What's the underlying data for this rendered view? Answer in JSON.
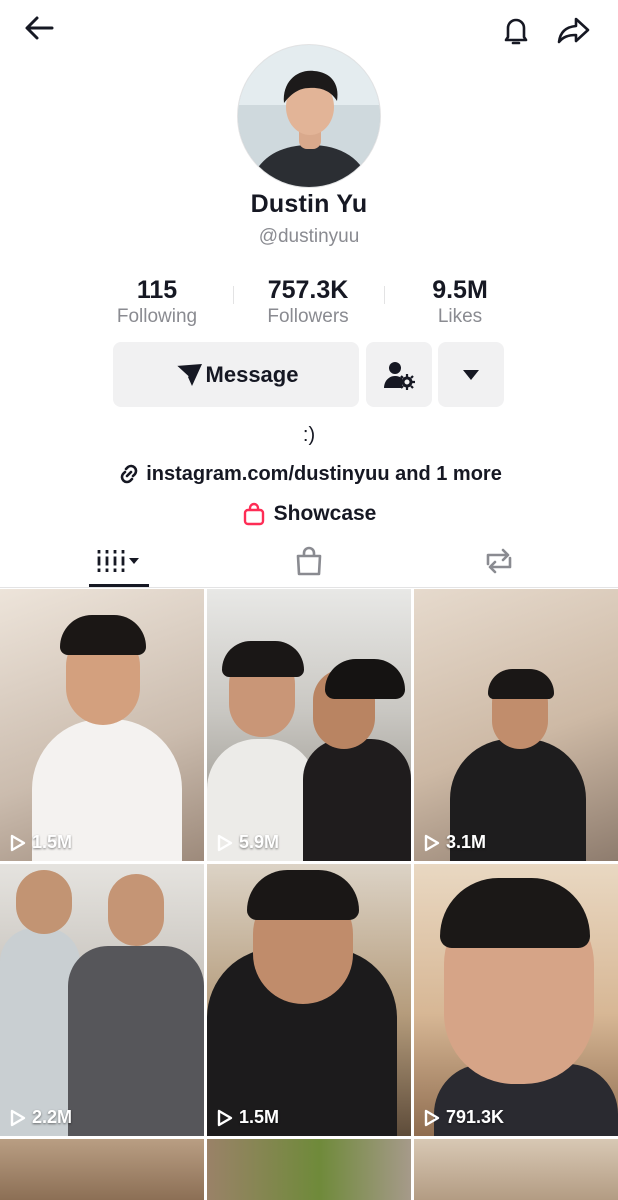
{
  "header": {
    "back_icon": "arrow-left-icon",
    "notify_icon": "bell-icon",
    "share_icon": "share-arrow-icon"
  },
  "profile": {
    "name": "Dustin Yu",
    "handle": "@dustinyuu",
    "stats": [
      {
        "value": "115",
        "label": "Following"
      },
      {
        "value": "757.3K",
        "label": "Followers"
      },
      {
        "value": "9.5M",
        "label": "Likes"
      }
    ],
    "message_label": "Message",
    "bio": ":)",
    "link_text": "instagram.com/dustinyuu and 1 more",
    "showcase_label": "Showcase",
    "accent_color": "#fe2c55"
  },
  "tabs": [
    {
      "name": "videos",
      "icon": "grid-bars-icon",
      "active": true
    },
    {
      "name": "shop",
      "icon": "shopping-bag-icon",
      "active": false
    },
    {
      "name": "reposts",
      "icon": "repost-icon",
      "active": false
    }
  ],
  "videos": [
    {
      "views": "1.5M"
    },
    {
      "views": "5.9M"
    },
    {
      "views": "3.1M"
    },
    {
      "views": "2.2M"
    },
    {
      "views": "1.5M"
    },
    {
      "views": "791.3K"
    },
    {
      "views": ""
    },
    {
      "views": ""
    },
    {
      "views": ""
    }
  ]
}
